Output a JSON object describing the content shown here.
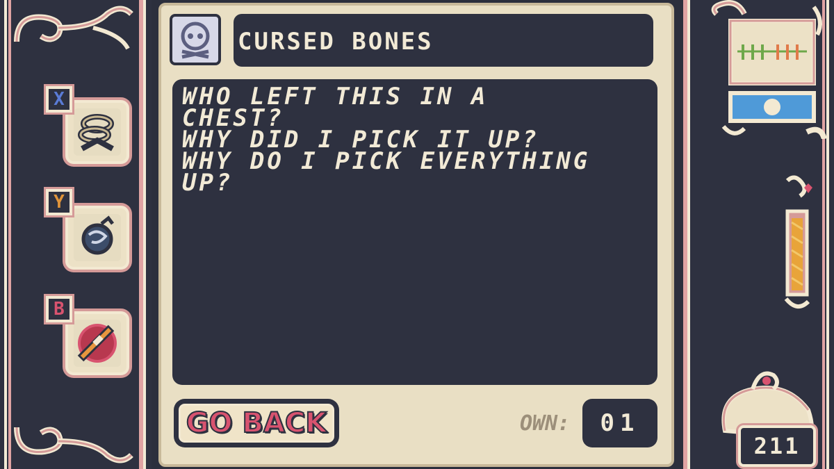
{
  "item": {
    "name": "CURSED BONES",
    "icon": "skull-icon",
    "description_lines": [
      "WHO LEFT THIS IN A",
      "CHEST?",
      "WHY DID I PICK IT UP?",
      "WHY DO I PICK EVERYTHING",
      "UP?"
    ]
  },
  "buttons": {
    "go_back": "GO BACK"
  },
  "ownership": {
    "label": "OWN:",
    "count": "01"
  },
  "equipped_slots": [
    {
      "key": "X",
      "key_color": "#5a7bd6",
      "icon": "rope-icon"
    },
    {
      "key": "Y",
      "key_color": "#e0943a",
      "icon": "bomb-icon"
    },
    {
      "key": "B",
      "key_color": "#d8536f",
      "icon": "fire-weapon-icon"
    }
  ],
  "status": {
    "gold": "211"
  },
  "colors": {
    "panel_dark": "#2e3140",
    "parchment": "#e9dfc4",
    "trim_pink": "#d59a98",
    "text_light": "#f2ead6",
    "accent_red": "#d8536f"
  }
}
